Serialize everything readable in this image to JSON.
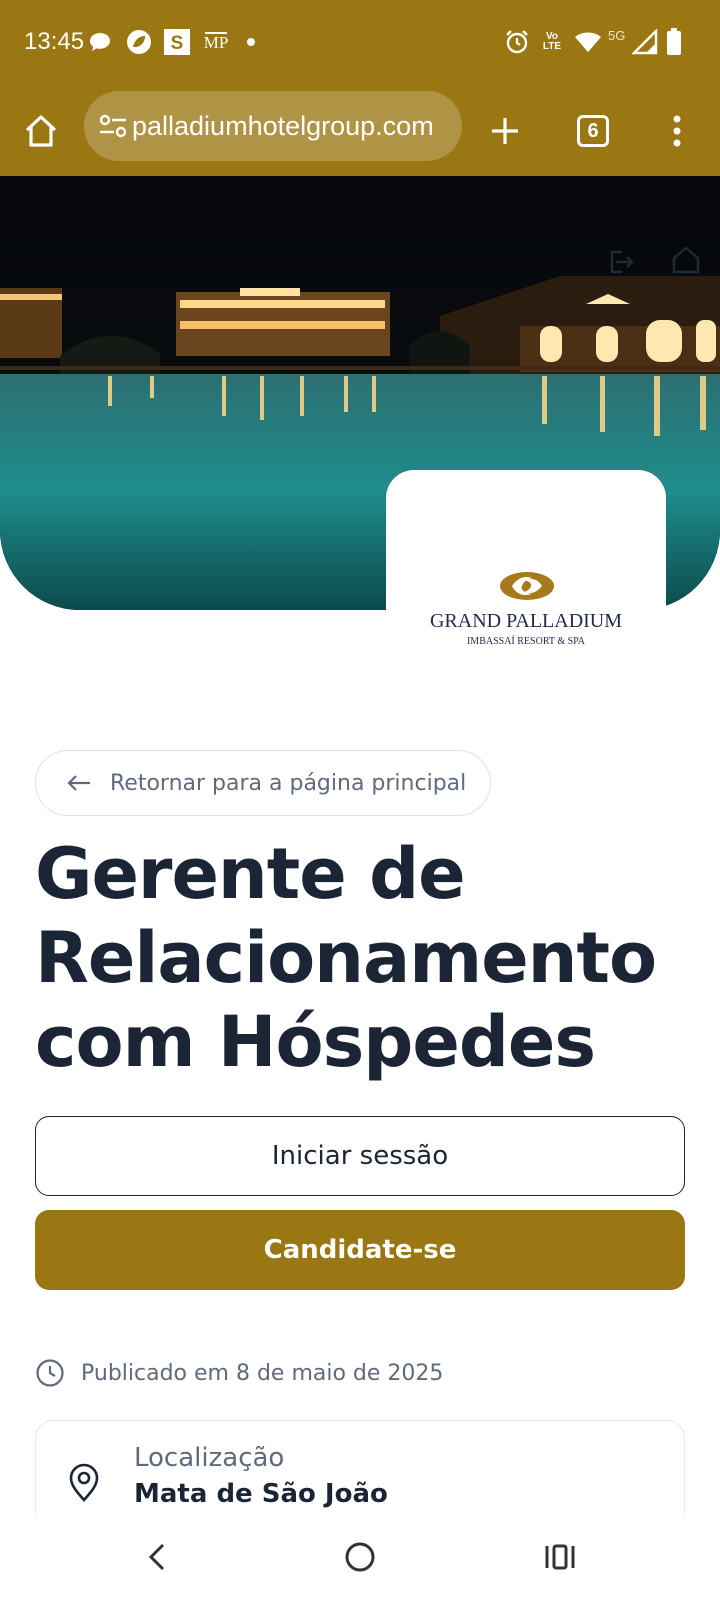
{
  "status_bar": {
    "time": "13:45",
    "icons": [
      "chat-bubble-icon",
      "leaf-icon",
      "s-app-icon",
      "mp-app-icon",
      "dot-icon",
      "alarm-icon",
      "volte-icon",
      "wifi-icon",
      "5g-signal-icon",
      "battery-icon"
    ],
    "network_label": "5G",
    "volte_label": "Vo LTE"
  },
  "browser": {
    "url": "palladiumhotelgroup.com",
    "tab_count": "6",
    "toolbar_color": "#9a7713"
  },
  "hero": {
    "logo_brand": "GRAND PALLADIUM",
    "logo_sub": "IMBASSAÍ RESORT & SPA"
  },
  "page": {
    "back_link": "Retornar para a página principal",
    "title": "Gerente de Relacionamento com Hóspedes",
    "login_button": "Iniciar sessão",
    "apply_button": "Candidate-se",
    "published": "Publicado em 8 de maio de 2025",
    "location_label": "Localização",
    "location_value": "Mata de São João"
  },
  "colors": {
    "accent": "#9a7713",
    "text_dark": "#1c2536",
    "text_muted": "#5f6b7c"
  }
}
